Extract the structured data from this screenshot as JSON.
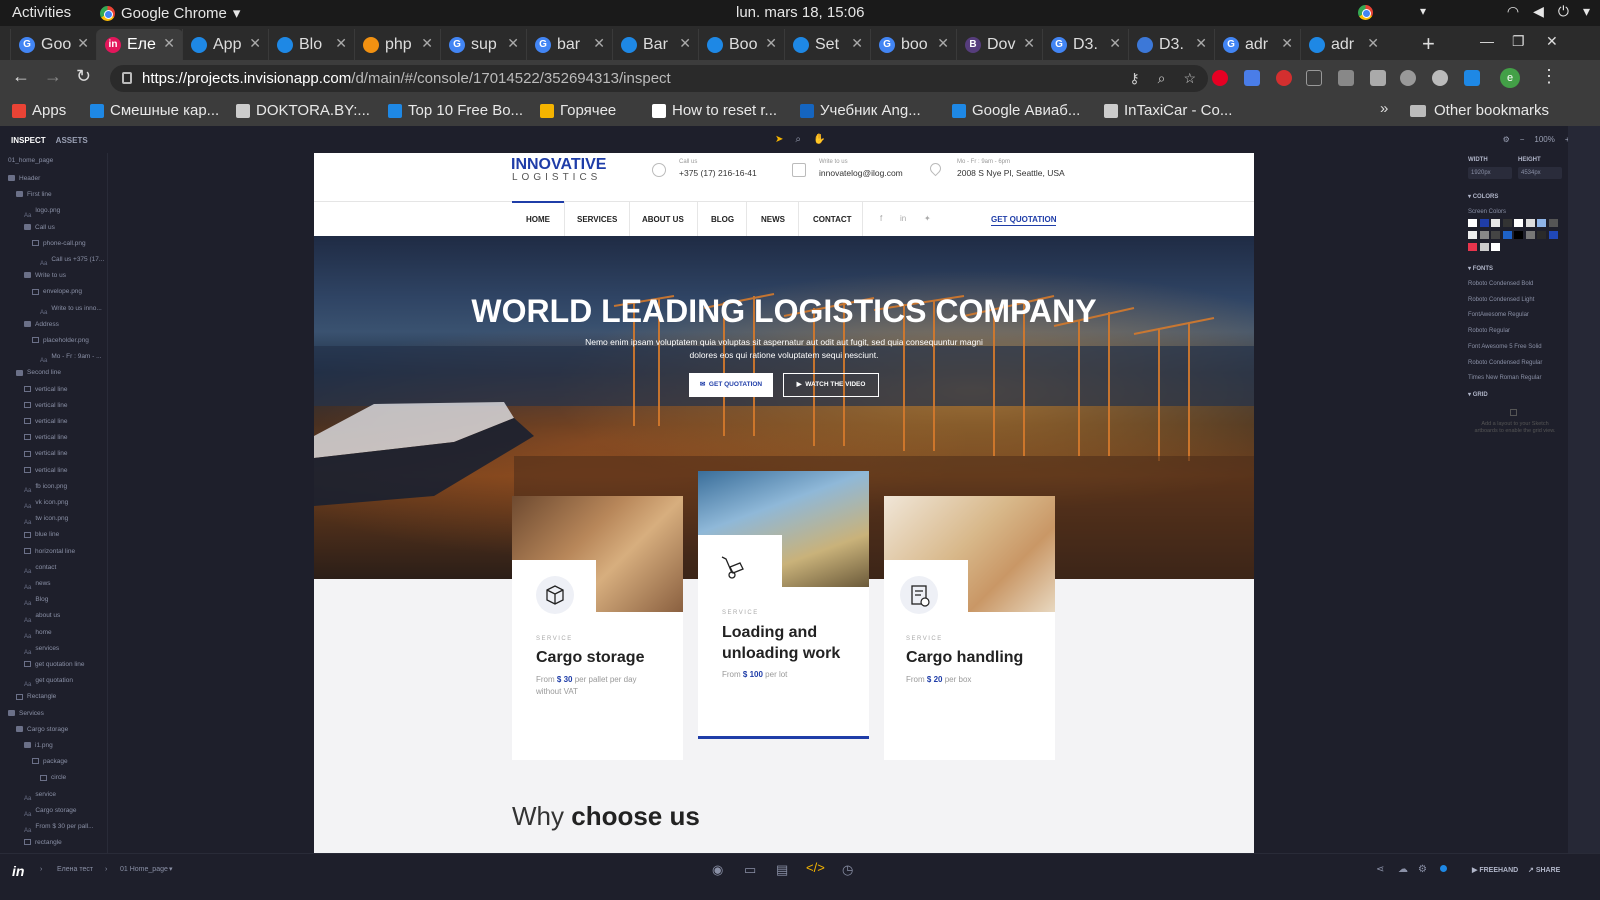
{
  "os": {
    "activities": "Activities",
    "app_name": "Google Chrome",
    "clock": "lun. mars 18, 15:06"
  },
  "tabs": [
    {
      "label": "Goo",
      "color": "#4285f4",
      "glyph": "G"
    },
    {
      "label": "Еле",
      "color": "#e3165b",
      "glyph": "in"
    },
    {
      "label": "App",
      "color": "#1e88e5",
      "glyph": ""
    },
    {
      "label": "Blo",
      "color": "#1e88e5",
      "glyph": ""
    },
    {
      "label": "php",
      "color": "#f29111",
      "glyph": ""
    },
    {
      "label": "sup",
      "color": "#4285f4",
      "glyph": "G"
    },
    {
      "label": "bar",
      "color": "#4285f4",
      "glyph": "G"
    },
    {
      "label": "Bar",
      "color": "#1e88e5",
      "glyph": ""
    },
    {
      "label": "Boo",
      "color": "#1e88e5",
      "glyph": ""
    },
    {
      "label": "Set",
      "color": "#1e88e5",
      "glyph": ""
    },
    {
      "label": "boo",
      "color": "#4285f4",
      "glyph": "G"
    },
    {
      "label": "Dov",
      "color": "#563d7c",
      "glyph": "B"
    },
    {
      "label": "D3.",
      "color": "#4285f4",
      "glyph": "G"
    },
    {
      "label": "D3.",
      "color": "#3c78d8",
      "glyph": ""
    },
    {
      "label": "adr",
      "color": "#4285f4",
      "glyph": "G"
    },
    {
      "label": "adr",
      "color": "#1e88e5",
      "glyph": ""
    }
  ],
  "url": {
    "host": "https://projects.invisionapp.com",
    "path": "/d/main/#/console/17014522/352694313/inspect"
  },
  "bookmarks": [
    {
      "label": "Apps",
      "color": "#ea4335"
    },
    {
      "label": "Смешные кар...",
      "color": "#1e88e5"
    },
    {
      "label": "DOKTORA.BY:...",
      "color": "#cccccc"
    },
    {
      "label": "Top 10 Free Bo...",
      "color": "#1e88e5"
    },
    {
      "label": "Горячее",
      "color": "#f5b400"
    },
    {
      "label": "How to reset r...",
      "color": "#ffffff"
    },
    {
      "label": "Учебник Ang...",
      "color": "#1565c0"
    },
    {
      "label": "Google Авиаб...",
      "color": "#1e88e5"
    },
    {
      "label": "InTaxiCar - Co...",
      "color": "#cccccc"
    }
  ],
  "other_bookmarks": "Other bookmarks",
  "inspector": {
    "tab_inspect": "INSPECT",
    "tab_assets": "ASSETS",
    "zoom": "100%",
    "page_name": "01_home_page",
    "layers": [
      {
        "label": "Header",
        "kind": "folder",
        "indent": 0
      },
      {
        "label": "First line",
        "kind": "folder",
        "indent": 1
      },
      {
        "label": "logo.png",
        "kind": "txt",
        "indent": 2
      },
      {
        "label": "Call us",
        "kind": "folder",
        "indent": 2
      },
      {
        "label": "phone-call.png",
        "kind": "group",
        "indent": 3
      },
      {
        "label": "Call us +375 (17...",
        "kind": "txt",
        "indent": 4
      },
      {
        "label": "Write to us",
        "kind": "folder",
        "indent": 2
      },
      {
        "label": "envelope.png",
        "kind": "group",
        "indent": 3
      },
      {
        "label": "Write to us inno...",
        "kind": "txt",
        "indent": 4
      },
      {
        "label": "Address",
        "kind": "folder",
        "indent": 2
      },
      {
        "label": "placeholder.png",
        "kind": "group",
        "indent": 3
      },
      {
        "label": "Mo - Fr : 9am - ...",
        "kind": "txt",
        "indent": 4
      },
      {
        "label": "Second line",
        "kind": "folder",
        "indent": 1
      },
      {
        "label": "vertical line",
        "kind": "rect",
        "indent": 2
      },
      {
        "label": "vertical line",
        "kind": "rect",
        "indent": 2
      },
      {
        "label": "vertical line",
        "kind": "rect",
        "indent": 2
      },
      {
        "label": "vertical line",
        "kind": "rect",
        "indent": 2
      },
      {
        "label": "vertical line",
        "kind": "rect",
        "indent": 2
      },
      {
        "label": "vertical line",
        "kind": "rect",
        "indent": 2
      },
      {
        "label": "fb icon.png",
        "kind": "txt",
        "indent": 2
      },
      {
        "label": "vk icon.png",
        "kind": "txt",
        "indent": 2
      },
      {
        "label": "tw icon.png",
        "kind": "txt",
        "indent": 2
      },
      {
        "label": "blue line",
        "kind": "rect",
        "indent": 2
      },
      {
        "label": "horizontal line",
        "kind": "rect",
        "indent": 2
      },
      {
        "label": "contact",
        "kind": "txt",
        "indent": 2
      },
      {
        "label": "news",
        "kind": "txt",
        "indent": 2
      },
      {
        "label": "Blog",
        "kind": "txt",
        "indent": 2
      },
      {
        "label": "about us",
        "kind": "txt",
        "indent": 2
      },
      {
        "label": "home",
        "kind": "txt",
        "indent": 2
      },
      {
        "label": "services",
        "kind": "txt",
        "indent": 2
      },
      {
        "label": "get quotation line",
        "kind": "rect",
        "indent": 2
      },
      {
        "label": "get quotation",
        "kind": "txt",
        "indent": 2
      },
      {
        "label": "Rectangle",
        "kind": "rect",
        "indent": 1
      },
      {
        "label": "Services",
        "kind": "folder",
        "indent": 0
      },
      {
        "label": "Cargo storage",
        "kind": "folder",
        "indent": 1
      },
      {
        "label": "i1.png",
        "kind": "folder",
        "indent": 2
      },
      {
        "label": "package",
        "kind": "group",
        "indent": 3
      },
      {
        "label": "circle",
        "kind": "rect",
        "indent": 4
      },
      {
        "label": "service",
        "kind": "txt",
        "indent": 2
      },
      {
        "label": "Cargo storage",
        "kind": "txt",
        "indent": 2
      },
      {
        "label": "From $ 30 per pall...",
        "kind": "txt",
        "indent": 2
      },
      {
        "label": "rectangle",
        "kind": "rect",
        "indent": 2
      }
    ],
    "width_label": "WIDTH",
    "height_label": "HEIGHT",
    "width_value": "1920px",
    "height_value": "4534px",
    "colors_label": "COLORS",
    "screen_colors": "Screen Colors",
    "swatches": [
      "#ffffff",
      "#1f3da8",
      "#e6e6e6",
      "#333333",
      "#ffffff",
      "#dddddd",
      "#8fb4e8",
      "#555555",
      "#eeeeee",
      "#888888",
      "#444444",
      "#1e62c8",
      "#000000",
      "#777777",
      "#2a2a2a",
      "#2048b8",
      "#e8344c",
      "#cccccc",
      "#ffffff"
    ],
    "fonts_label": "FONTS",
    "fonts": [
      "Roboto Condensed Bold",
      "Roboto Condensed Light",
      "FontAwesome Regular",
      "Roboto Regular",
      "Font Awesome 5 Free Solid",
      "Roboto Condensed Regular",
      "Times New Roman Regular"
    ],
    "grid_label": "GRID",
    "grid_note": "Add a layout to your Sketch artboards to enable the grid view."
  },
  "bottom": {
    "project": "Елена тест",
    "screen": "01 Home_page",
    "freehand": "FREEHAND",
    "share": "SHARE"
  },
  "site": {
    "logo_main": "INNOVATIVE",
    "logo_sub": "LOGISTICS",
    "call_label": "Call us",
    "call_value": "+375 (17) 216-16-41",
    "write_label": "Write to us",
    "write_value": "innovatelog@ilog.com",
    "hours_label": "Mo - Fr : 9am - 6pm",
    "address_value": "2008 S Nye Pl, Seattle, USA",
    "nav": [
      "HOME",
      "SERVICES",
      "ABOUT US",
      "BLOG",
      "NEWS",
      "CONTACT"
    ],
    "get_quotation": "GET QUOTATION",
    "hero_title": "WORLD LEADING LOGISTICS COMPANY",
    "hero_sub": "Nemo enim ipsam voluptatem quia voluptas sit aspernatur aut odit aut fugit, sed quia consequuntur magni dolores eos qui ratione voluptatem sequi nesciunt.",
    "btn_quote": "GET QUOTATION",
    "btn_video": "WATCH THE VIDEO",
    "cards": [
      {
        "service": "SERVICE",
        "title": "Cargo storage",
        "from": "From",
        "price": "$ 30",
        "unit": "per pallet per day without VAT"
      },
      {
        "service": "SERVICE",
        "title": "Loading and unloading work",
        "from": "From",
        "price": "$ 100",
        "unit": "per lot"
      },
      {
        "service": "SERVICE",
        "title": "Cargo handling",
        "from": "From",
        "price": "$ 20",
        "unit": "per box"
      }
    ],
    "why_light": "Why",
    "why_bold": "choose us"
  }
}
